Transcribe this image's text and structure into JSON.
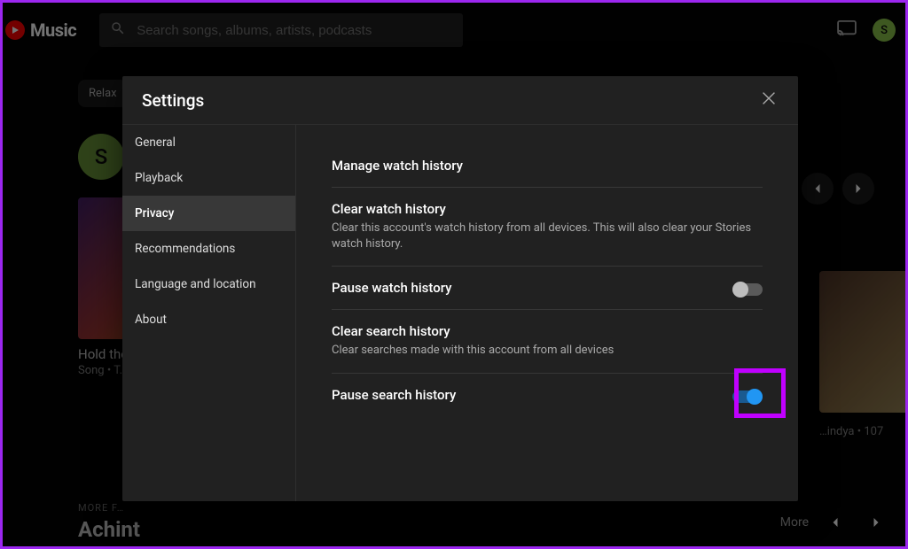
{
  "header": {
    "logo_text": "Music",
    "search_placeholder": "Search songs, albums, artists, podcasts",
    "avatar_letter": "S"
  },
  "bg": {
    "chip_relax": "Relax",
    "hero_letter": "S",
    "card1_title": "Hold the…",
    "card1_sub": "Song • T…",
    "card2_sub_right": "…indya • 107",
    "more_from": "MORE F…",
    "artist": "Achint",
    "more_label": "More"
  },
  "modal": {
    "title": "Settings",
    "sidebar": [
      {
        "label": "General"
      },
      {
        "label": "Playback"
      },
      {
        "label": "Privacy",
        "active": true
      },
      {
        "label": "Recommendations"
      },
      {
        "label": "Language and location"
      },
      {
        "label": "About"
      }
    ],
    "rows": {
      "manage": {
        "title": "Manage watch history"
      },
      "clear_watch": {
        "title": "Clear watch history",
        "desc": "Clear this account's watch history from all devices. This will also clear your Stories watch history."
      },
      "pause_watch": {
        "title": "Pause watch history",
        "on": false
      },
      "clear_search": {
        "title": "Clear search history",
        "desc": "Clear searches made with this account from all devices"
      },
      "pause_search": {
        "title": "Pause search history",
        "on": true
      }
    }
  }
}
